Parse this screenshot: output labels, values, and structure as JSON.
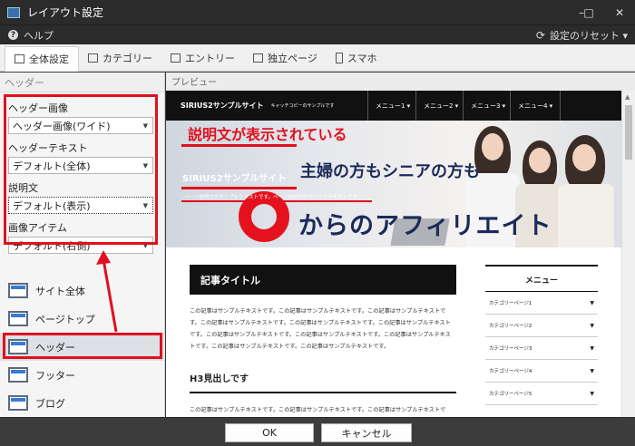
{
  "window": {
    "title": "レイアウト設定",
    "minimize": "–",
    "maximize": "□",
    "close": "✕"
  },
  "menubar": {
    "help": "ヘルプ",
    "reset": "設定のリセット ▾"
  },
  "tabs": [
    {
      "label": "全体設定"
    },
    {
      "label": "カテゴリー"
    },
    {
      "label": "エントリー"
    },
    {
      "label": "独立ページ"
    },
    {
      "label": "スマホ"
    }
  ],
  "left": {
    "section_title": "ヘッダー",
    "fields": [
      {
        "label": "ヘッダー画像",
        "value": "ヘッダー画像(ワイド)"
      },
      {
        "label": "ヘッダーテキスト",
        "value": "デフォルト(全体)"
      },
      {
        "label": "説明文",
        "value": "デフォルト(表示)"
      },
      {
        "label": "画像アイテム",
        "value": "デフォルト(右側)"
      }
    ],
    "nav": [
      {
        "label": "サイト全体"
      },
      {
        "label": "ページトップ"
      },
      {
        "label": "ヘッダー"
      },
      {
        "label": "フッター"
      },
      {
        "label": "ブログ"
      }
    ]
  },
  "preview": {
    "title": "プレビュー",
    "site": {
      "brand": "SIRIUS2サンプルサイト",
      "catch": "キャッチコピーのサンプルです",
      "menus": [
        "メニュー1 ▾",
        "メニュー2 ▾",
        "メニュー3 ▾",
        "メニュー4 ▾"
      ],
      "hero_caption": "説明文が表示されている",
      "hero_title": "SIRIUS2サンプルサイト",
      "hero_desc": "ページ説明文のサンプルテキストです。ページ説明文のサンプルテキストです。",
      "hero_sub": "主婦の方もシニアの方も",
      "hero_big": "からのアフィリエイト",
      "article_title": "記事タイトル",
      "article_body": "この記事はサンプルテキストです。この記事はサンプルテキストです。この記事はサンプルテキストです。この記事はサンプルテキストです。この記事はサンプルテキストです。この記事はサンプルテキストです。この記事はサンプルテキストです。この記事はサンプルテキストです。この記事はサンプルテキストです。この記事はサンプルテキストです。この記事はサンプルテキストです。",
      "h3": "H3見出しです",
      "h3_body": "この記事はサンプルテキストです。この記事はサンプルテキストです。この記事はサンプルテキストです。この記事はサンプルテキストです。",
      "side_title": "メニュー",
      "side_items": [
        "カテゴリーページ1",
        "カテゴリーページ2",
        "カテゴリーページ3",
        "カテゴリーページ4",
        "カテゴリーページ5"
      ]
    }
  },
  "buttons": {
    "ok": "OK",
    "cancel": "キャンセル"
  },
  "colors": {
    "annotation": "#e0101e",
    "titlebar": "#2b2b2b"
  }
}
